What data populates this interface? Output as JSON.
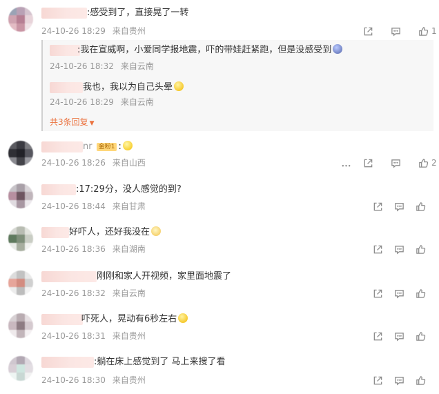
{
  "comments": [
    {
      "text": ":感受到了，直接晃了一转",
      "time": "24-10-26 18:29",
      "location": "来自贵州",
      "likes": "1",
      "replies": [
        {
          "text": ":我在宣威啊，小爱同学报地震，吓的带娃赶紧跑，但是没感受到",
          "time": "24-10-26 18:32",
          "location": "来自云南"
        },
        {
          "text": "我也，我以为自己头晕",
          "time": "24-10-26 18:29",
          "location": "来自云南"
        }
      ],
      "more_replies": "共3条回复"
    },
    {
      "name_suffix": "nr",
      "badge": "金粉1",
      "text": ":",
      "time": "24-10-26 18:26",
      "location": "来自山西",
      "likes": "2"
    },
    {
      "text": ":17:29分，没人感觉的到?",
      "time": "24-10-26 18:44",
      "location": "来自甘肃"
    },
    {
      "text": "好吓人，还好我没在",
      "time": "24-10-26 18:36",
      "location": "来自湖南"
    },
    {
      "text": "刚刚和家人开视频，家里面地震了",
      "time": "24-10-26 18:32",
      "location": "来自云南"
    },
    {
      "text": "吓死人，晃动有6秒左右",
      "time": "24-10-26 18:31",
      "location": "来自贵州"
    },
    {
      "text": ":躺在床上感觉到了 马上来搜了看",
      "time": "24-10-26 18:30",
      "location": "来自贵州"
    }
  ],
  "icons": {
    "share": "share-icon",
    "comment": "comment-icon",
    "like": "thumbs-up-icon",
    "more": "more-icon"
  }
}
